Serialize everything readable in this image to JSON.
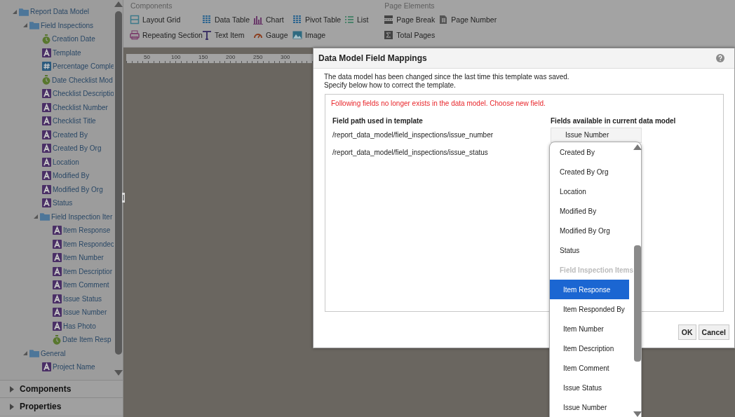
{
  "sidebar": {
    "tree": [
      {
        "label": "Report Data Model",
        "kind": "folder",
        "expanded": true,
        "children": [
          {
            "label": "Field Inspections",
            "kind": "folder",
            "expanded": true,
            "children": [
              {
                "label": "Creation Date",
                "kind": "date"
              },
              {
                "label": "Template",
                "kind": "text"
              },
              {
                "label": "Percentage Comple",
                "kind": "number"
              },
              {
                "label": "Date Checklist Mod",
                "kind": "date"
              },
              {
                "label": "Checklist Descriptio",
                "kind": "text"
              },
              {
                "label": "Checklist Number",
                "kind": "text"
              },
              {
                "label": "Checklist Title",
                "kind": "text"
              },
              {
                "label": "Created By",
                "kind": "text"
              },
              {
                "label": "Created By Org",
                "kind": "text"
              },
              {
                "label": "Location",
                "kind": "text"
              },
              {
                "label": "Modified By",
                "kind": "text"
              },
              {
                "label": "Modified By Org",
                "kind": "text"
              },
              {
                "label": "Status",
                "kind": "text"
              },
              {
                "label": "Field Inspection Iter",
                "kind": "folder",
                "expanded": true,
                "children": [
                  {
                    "label": "Item Response",
                    "kind": "text"
                  },
                  {
                    "label": "Item Respondec",
                    "kind": "text"
                  },
                  {
                    "label": "Item Number",
                    "kind": "text"
                  },
                  {
                    "label": "Item Descriptior",
                    "kind": "text"
                  },
                  {
                    "label": "Item Comment",
                    "kind": "text"
                  },
                  {
                    "label": "Issue Status",
                    "kind": "text"
                  },
                  {
                    "label": "Issue Number",
                    "kind": "text"
                  },
                  {
                    "label": "Has Photo",
                    "kind": "text"
                  },
                  {
                    "label": "Date Item Resp",
                    "kind": "date"
                  }
                ]
              }
            ]
          },
          {
            "label": "General",
            "kind": "folder",
            "expanded": true,
            "children": [
              {
                "label": "Project Name",
                "kind": "text"
              }
            ]
          }
        ]
      }
    ],
    "sections": [
      {
        "label": "Components",
        "expanded": false
      },
      {
        "label": "Properties",
        "expanded": false
      }
    ]
  },
  "toolbar": {
    "groups": [
      {
        "title": "Components",
        "items": [
          {
            "label": "Layout Grid",
            "kind": "layout-grid"
          },
          {
            "label": "Data Table",
            "kind": "data-table"
          },
          {
            "label": "Chart",
            "kind": "chart"
          },
          {
            "label": "Pivot Table",
            "kind": "pivot-table"
          },
          {
            "label": "List",
            "kind": "list"
          },
          {
            "label": "Repeating Section",
            "kind": "repeating-section"
          },
          {
            "label": "Text Item",
            "kind": "text-item"
          },
          {
            "label": "Gauge",
            "kind": "gauge"
          },
          {
            "label": "Image",
            "kind": "image"
          }
        ]
      },
      {
        "title": "Page Elements",
        "items": [
          {
            "label": "Page Break",
            "kind": "page-break"
          },
          {
            "label": "Page Number",
            "kind": "page-number"
          },
          {
            "label": "Total Pages",
            "kind": "total-pages"
          }
        ]
      }
    ]
  },
  "ruler": {
    "labels": [
      "50",
      "100",
      "150",
      "200",
      "250",
      "300"
    ]
  },
  "dialog": {
    "title": "Data Model Field Mappings",
    "intro": [
      "The data model has been changed since the last time this template was saved.",
      "Specify below how to correct the template."
    ],
    "message": "Following fields no longer exists in the data model. Choose new field.",
    "columns": [
      "Field path used in template",
      "Fields available in current data model"
    ],
    "rows": [
      {
        "path": "/report_data_model/field_inspections/issue_number",
        "value": "Issue Number"
      },
      {
        "path": "/report_data_model/field_inspections/issue_status"
      }
    ],
    "dropdown": {
      "items": [
        {
          "label": "Created By",
          "kind": "option",
          "selected": false
        },
        {
          "label": "Created By Org",
          "kind": "option",
          "selected": false
        },
        {
          "label": "Location",
          "kind": "option",
          "selected": false
        },
        {
          "label": "Modified By",
          "kind": "option",
          "selected": false
        },
        {
          "label": "Modified By Org",
          "kind": "option",
          "selected": false
        },
        {
          "label": "Status",
          "kind": "option",
          "selected": false
        },
        {
          "label": "Field Inspection Items",
          "kind": "group",
          "children": [
            {
              "label": "Item Response",
              "kind": "option",
              "selected": true
            },
            {
              "label": "Item Responded By",
              "kind": "option",
              "selected": false
            },
            {
              "label": "Item Number",
              "kind": "option",
              "selected": false
            },
            {
              "label": "Item Description",
              "kind": "option",
              "selected": false
            },
            {
              "label": "Item Comment",
              "kind": "option",
              "selected": false
            },
            {
              "label": "Issue Status",
              "kind": "option",
              "selected": false
            },
            {
              "label": "Issue Number",
              "kind": "option",
              "selected": false
            }
          ]
        }
      ]
    },
    "buttons": [
      "OK",
      "Cancel"
    ]
  }
}
